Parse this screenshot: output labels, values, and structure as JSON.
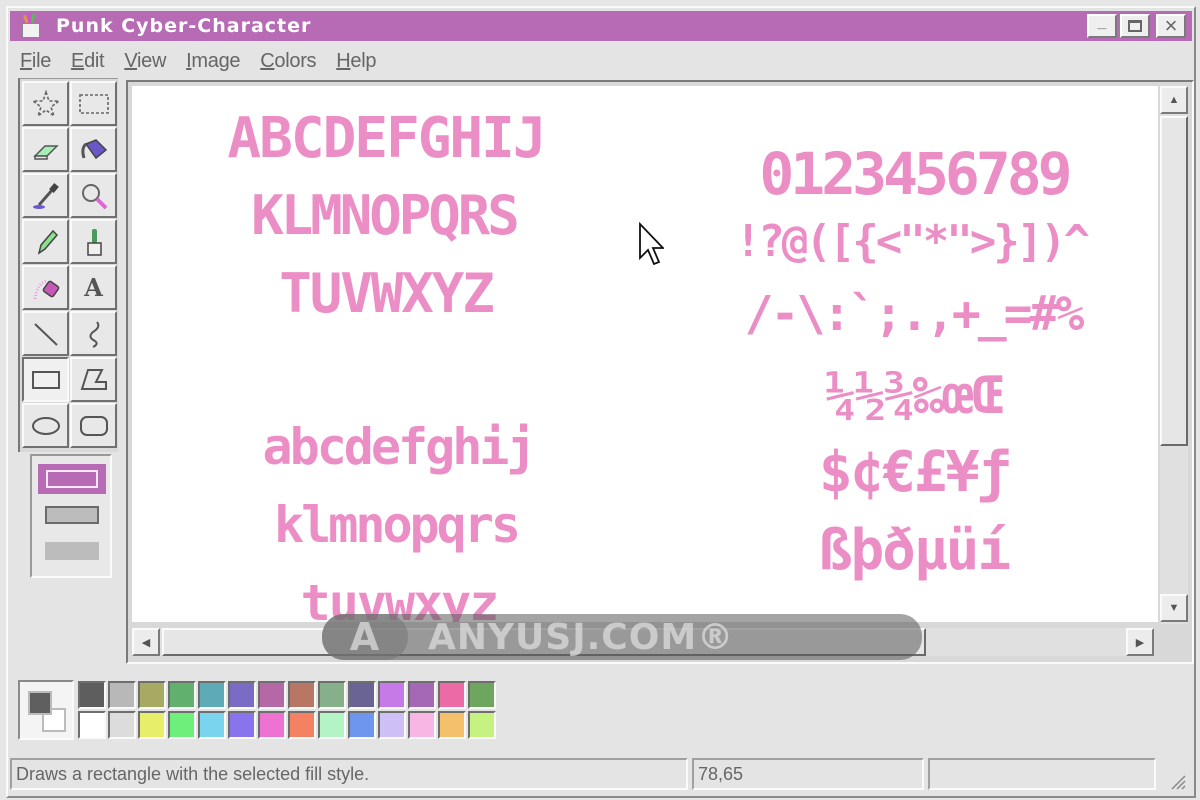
{
  "window": {
    "title": "Punk Cyber-Character",
    "buttons": {
      "minimize": "_",
      "maximize": "□",
      "close": "×"
    },
    "accent_color": "#b86bb5"
  },
  "menubar": {
    "items": [
      {
        "label": "File",
        "accel": "F"
      },
      {
        "label": "Edit",
        "accel": "E"
      },
      {
        "label": "View",
        "accel": "V"
      },
      {
        "label": "Image",
        "accel": "I"
      },
      {
        "label": "Colors",
        "accel": "C"
      },
      {
        "label": "Help",
        "accel": "H"
      }
    ]
  },
  "toolbox": {
    "tools": [
      {
        "name": "free-form-select",
        "icon": "star-select-icon"
      },
      {
        "name": "select",
        "icon": "rect-select-icon"
      },
      {
        "name": "eraser",
        "icon": "eraser-icon"
      },
      {
        "name": "fill",
        "icon": "paint-bucket-icon"
      },
      {
        "name": "pick-color",
        "icon": "eyedropper-icon"
      },
      {
        "name": "magnifier",
        "icon": "magnifier-icon"
      },
      {
        "name": "pencil",
        "icon": "pencil-icon"
      },
      {
        "name": "brush",
        "icon": "brush-icon"
      },
      {
        "name": "airbrush",
        "icon": "airbrush-icon"
      },
      {
        "name": "text",
        "icon": "text-icon",
        "glyph": "A"
      },
      {
        "name": "line",
        "icon": "line-icon"
      },
      {
        "name": "curve",
        "icon": "curve-icon"
      },
      {
        "name": "rectangle",
        "icon": "rectangle-icon",
        "selected": true
      },
      {
        "name": "polygon",
        "icon": "polygon-icon"
      },
      {
        "name": "ellipse",
        "icon": "ellipse-icon"
      },
      {
        "name": "rounded-rectangle",
        "icon": "rounded-rect-icon"
      }
    ],
    "fill_styles": [
      {
        "name": "outline",
        "selected": true
      },
      {
        "name": "outline-with-fill",
        "selected": false
      },
      {
        "name": "fill-only",
        "selected": false
      }
    ]
  },
  "canvas": {
    "glyph_color": "#ec8ec6",
    "rows": {
      "upper1": "ABCDEFGHIJ",
      "upper2": "KLMNOPQRS",
      "upper3": "TUVWXYZ",
      "lower1": "abcdefghij",
      "lower2": "klmnopqrs",
      "lower3": "tuvwxyz",
      "digits": "0123456789",
      "punct1": "!?@([{<\"*\">}])^",
      "punct2": "/-\\:`;.,+_=#%",
      "fractions": "¼½¾‰œŒ",
      "currency": "$¢€£¥ƒ",
      "accented": "ßþðµüí"
    }
  },
  "watermark": {
    "text": "ANYUSJ.COM®"
  },
  "palette": {
    "foreground": "#5f5f5f",
    "background": "#ffffff",
    "top_row": [
      "#5e5e5e",
      "#b8b8b8",
      "#a6aa62",
      "#62b06e",
      "#5eaab6",
      "#7a6cc4",
      "#b468a6",
      "#b87664",
      "#86b08a",
      "#6a6494",
      "#c67ae8",
      "#a468b6",
      "#ec6aa6",
      "#6ea660",
      "#ffffff"
    ],
    "bottom_row": [
      "#ffffff",
      "#dcdcdc",
      "#e6ee6a",
      "#6eee7a",
      "#7ad4ee",
      "#8a74ee",
      "#ee72d2",
      "#f48262",
      "#b4f4c4",
      "#6e96ee",
      "#cec0f6",
      "#f8b6e6",
      "#f4c06c",
      "#c6f282",
      "#ffffff"
    ]
  },
  "statusbar": {
    "help_text": "Draws a rectangle with the selected fill style.",
    "coordinates": "78,65",
    "size": ""
  },
  "scrollbars": {
    "up": "▲",
    "down": "▼",
    "left": "◀",
    "right": "▶"
  }
}
